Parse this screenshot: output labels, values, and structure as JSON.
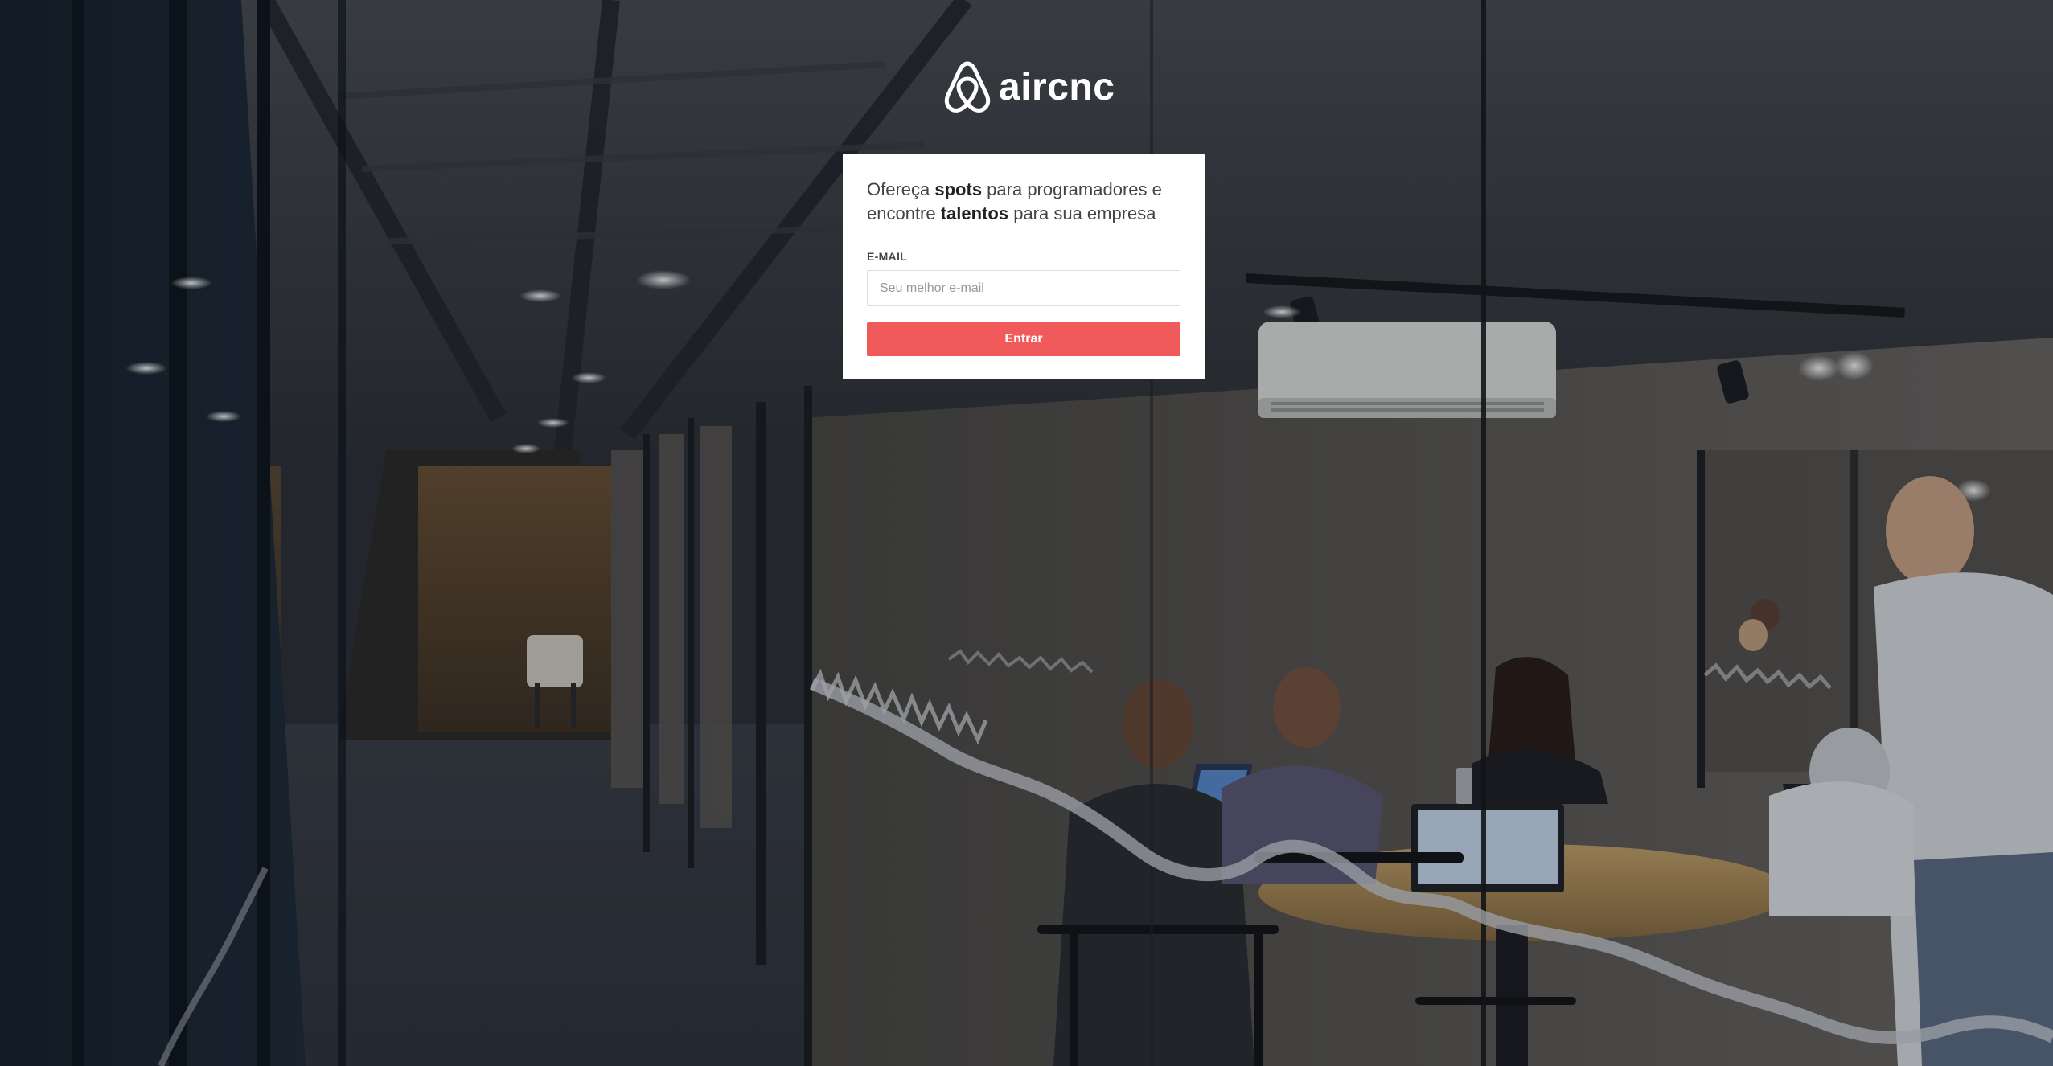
{
  "brand": {
    "name": "aircnc",
    "logo_icon": "airbnb-belo-icon"
  },
  "card": {
    "headline": {
      "part1": "Ofereça ",
      "bold1": "spots",
      "part2": " para programadores e encontre ",
      "bold2": "talentos",
      "part3": " para sua empresa"
    },
    "email_label": "E-MAIL",
    "email_value": "",
    "email_placeholder": "Seu melhor e-mail",
    "submit_label": "Entrar"
  },
  "colors": {
    "accent": "#f05a5b",
    "card_background": "#ffffff"
  },
  "background": {
    "description_icon": "office-meeting-room-photo"
  }
}
